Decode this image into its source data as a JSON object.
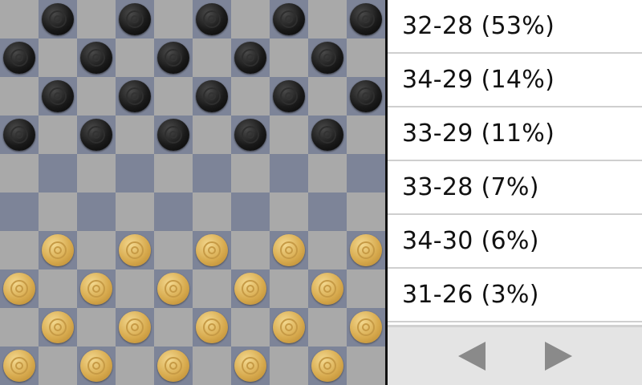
{
  "board": {
    "size": 10,
    "colors": {
      "light_square": "#a9a9a9",
      "dark_square": "#7d8498"
    },
    "black_rows": [
      0,
      1,
      2,
      3
    ],
    "white_rows": [
      6,
      7,
      8,
      9
    ]
  },
  "moves": [
    {
      "label": "32-28 (53%)"
    },
    {
      "label": "34-29 (14%)"
    },
    {
      "label": "33-29 (11%)"
    },
    {
      "label": "33-28 (7%)"
    },
    {
      "label": "34-30 (6%)"
    },
    {
      "label": "31-26 (3%)"
    }
  ],
  "nav": {
    "prev_icon": "left-triangle-icon",
    "next_icon": "right-triangle-icon"
  }
}
